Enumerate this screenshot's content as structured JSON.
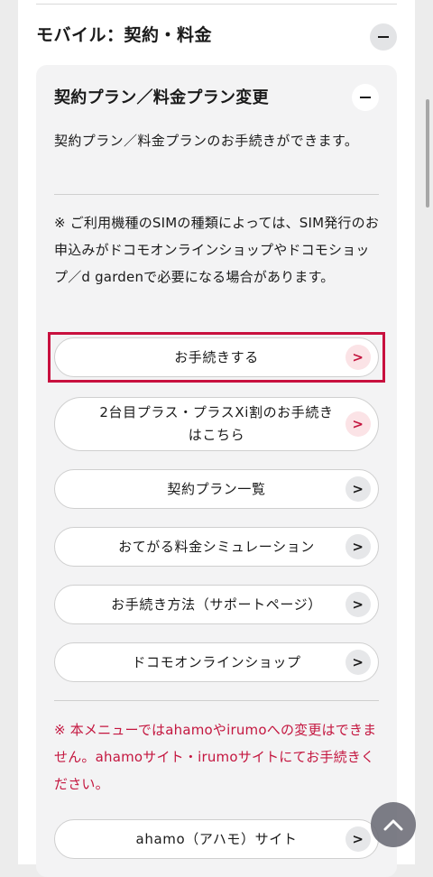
{
  "section": {
    "title": "モバイル：契約・料金",
    "collapse_icon": "minus-icon"
  },
  "panel": {
    "title": "契約プラン／料金プラン変更",
    "collapse_icon": "minus-icon",
    "description": "契約プラン／料金プランのお手続きができます。",
    "note": "※ ご利用機種のSIMの種類によっては、SIM発行のお申込みがドコモオンラインショップやドコモショップ／d gardenで必要になる場合があります。",
    "buttons": [
      {
        "label": "お手続きする",
        "icon": "chevron-right-icon",
        "accent": true
      },
      {
        "label": "2台目プラス・プラスXi割のお手続きはこちら",
        "icon": "chevron-right-icon",
        "accent": true
      },
      {
        "label": "契約プラン一覧",
        "icon": "chevron-right-icon",
        "accent": false
      },
      {
        "label": "おてがる料金シミュレーション",
        "icon": "chevron-right-icon",
        "accent": false
      },
      {
        "label": "お手続き方法（サポートページ）",
        "icon": "chevron-right-icon",
        "accent": false
      },
      {
        "label": "ドコモオンラインショップ",
        "icon": "chevron-right-icon",
        "accent": false
      }
    ],
    "warning": "※ 本メニューではahamoやirumoへの変更はできません。ahamoサイト・irumoサイトにてお手続きください。",
    "bottom_button": {
      "label": "ahamo（アハモ）サイト",
      "icon": "chevron-right-icon"
    }
  },
  "scroll_top": {
    "icon": "chevron-up-icon"
  },
  "colors": {
    "accent": "#c8103e",
    "page_bg": "#ececec",
    "panel_bg": "#f3f3f4"
  }
}
